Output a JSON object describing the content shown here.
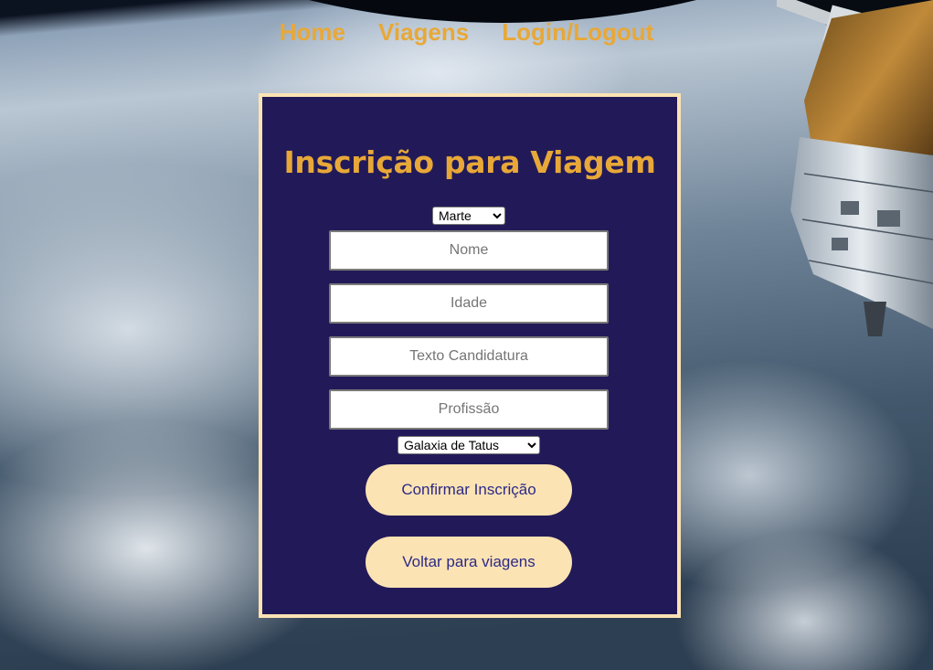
{
  "nav": {
    "home": "Home",
    "viagens": "Viagens",
    "login": "Login/Logout"
  },
  "form": {
    "title": "Inscrição para Viagem",
    "destination_select": {
      "selected": "Marte",
      "options": [
        "Marte"
      ]
    },
    "fields": {
      "nome_placeholder": "Nome",
      "idade_placeholder": "Idade",
      "texto_placeholder": "Texto Candidatura",
      "profissao_placeholder": "Profissão"
    },
    "origin_select": {
      "selected": "Galaxia de Tatus",
      "options": [
        "Galaxia de Tatus"
      ]
    },
    "confirm_label": "Confirmar Inscrição",
    "back_label": "Voltar para viagens"
  },
  "colors": {
    "accent": "#e8a838",
    "card_bg": "#221a58",
    "card_border": "#fce3b4",
    "button_bg": "#fce3b4",
    "button_text": "#2c2a86"
  },
  "background": {
    "image": "earth-from-orbit-with-space-station"
  }
}
